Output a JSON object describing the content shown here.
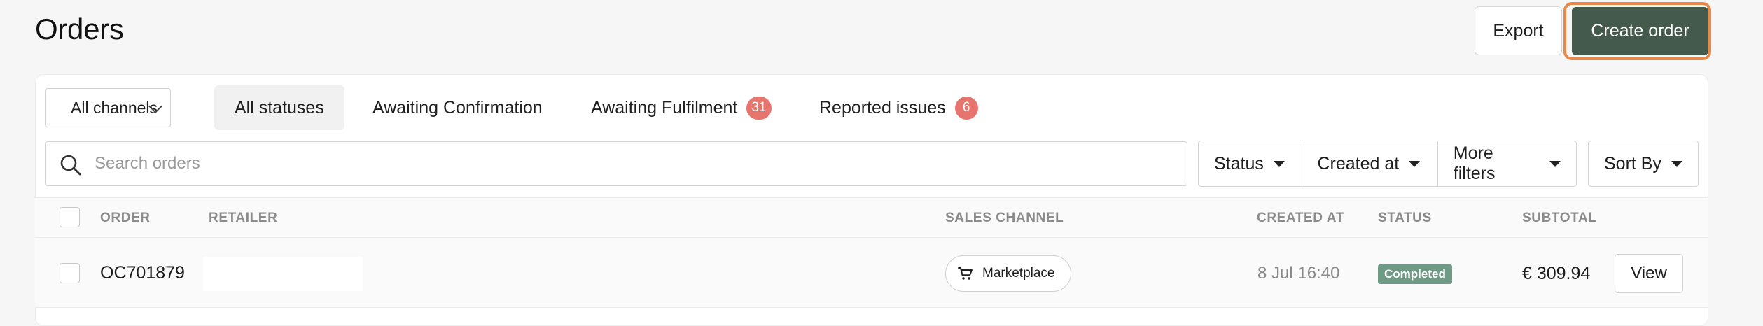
{
  "header": {
    "title": "Orders",
    "export_label": "Export",
    "create_label": "Create order"
  },
  "filters_bar": {
    "channel_select": "All channels",
    "tabs": [
      {
        "label": "All statuses",
        "active": true
      },
      {
        "label": "Awaiting Confirmation"
      },
      {
        "label": "Awaiting Fulfilment",
        "badge": "31"
      },
      {
        "label": "Reported issues",
        "badge": "6"
      }
    ]
  },
  "search": {
    "placeholder": "Search orders"
  },
  "filters": {
    "status": "Status",
    "created_at": "Created at",
    "more": "More filters",
    "sort": "Sort By"
  },
  "table": {
    "columns": {
      "order": "ORDER",
      "retailer": "RETAILER",
      "sales_channel": "SALES CHANNEL",
      "created_at": "CREATED AT",
      "status": "STATUS",
      "subtotal": "SUBTOTAL"
    },
    "rows": [
      {
        "order": "OC701879",
        "retailer": "",
        "sales_channel": "Marketplace",
        "created_at": "8 Jul 16:40",
        "status": "Completed",
        "subtotal": "€ 309.94",
        "action": "View"
      }
    ]
  },
  "colors": {
    "primary": "#445a4c",
    "focus_ring": "#e8894a",
    "badge": "#e8746e",
    "status_completed": "#6f9a85"
  }
}
